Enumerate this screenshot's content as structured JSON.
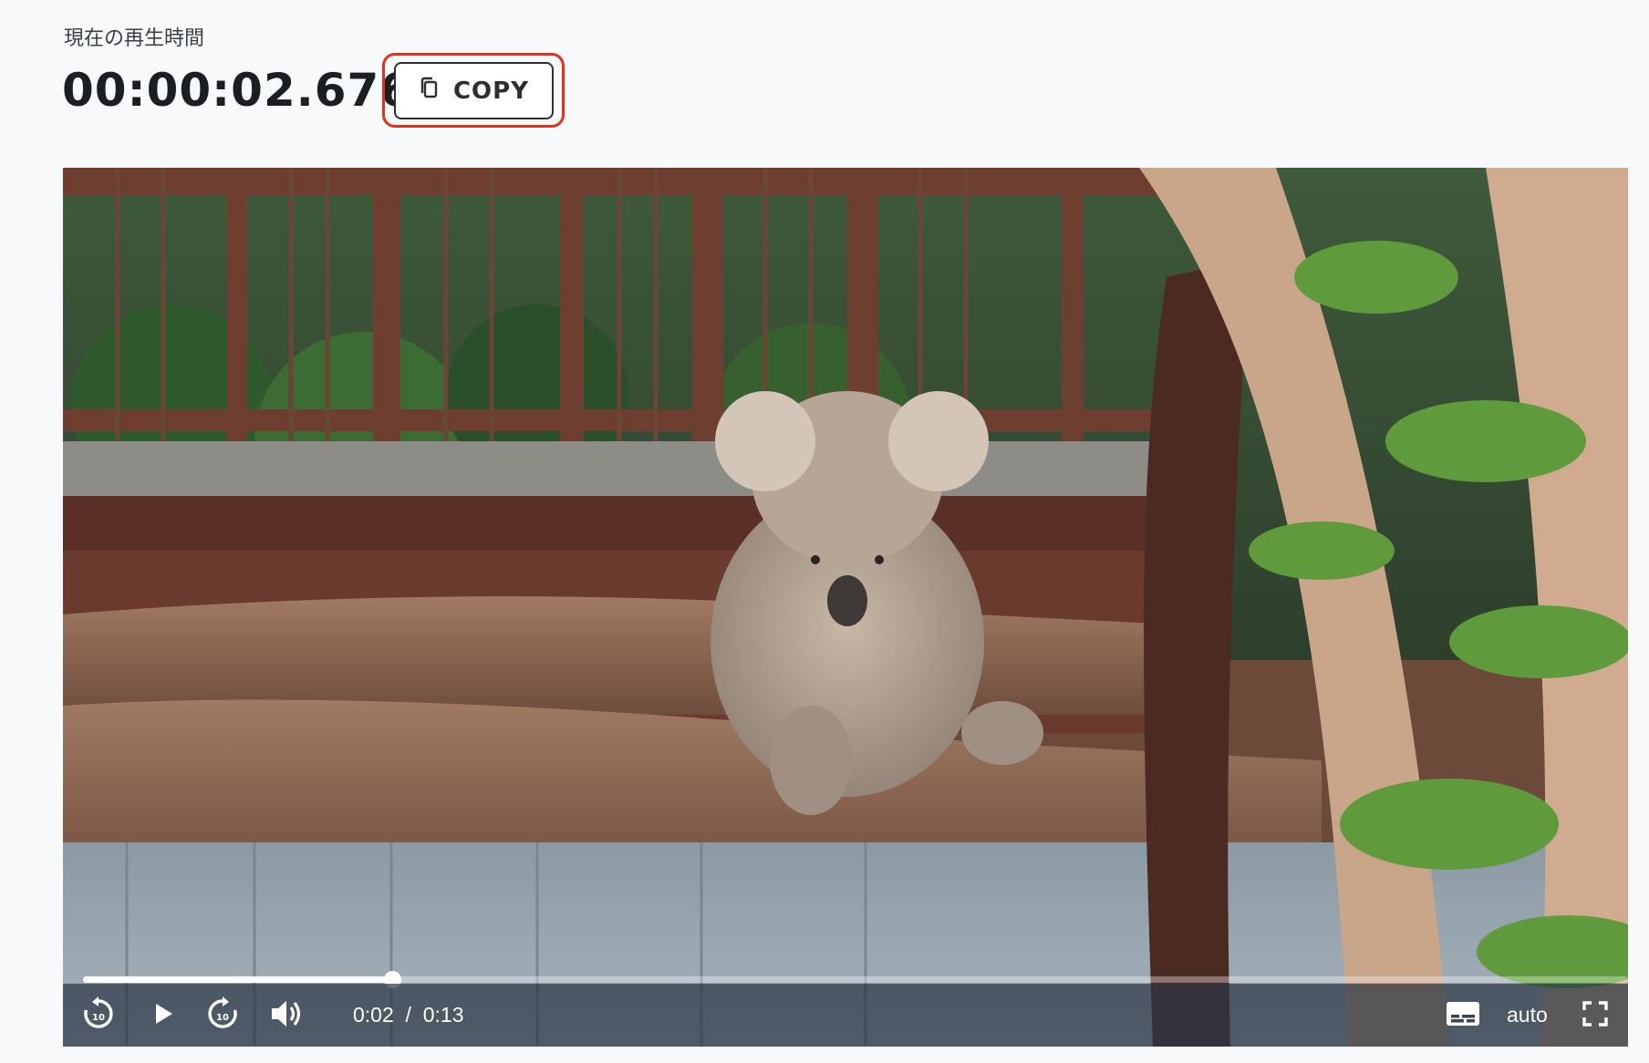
{
  "current_time": {
    "label": "現在の再生時間",
    "value": "00:00:02.676"
  },
  "copy_button": {
    "label": "COPY",
    "icon": "copy-icon",
    "highlight_color": "#e0331f"
  },
  "player": {
    "current": "0:02",
    "separator": "/",
    "duration": "0:13",
    "progress": 0.2,
    "quality": "auto",
    "icons": [
      "replay-10-icon",
      "play-icon",
      "forward-10-icon",
      "volume-icon",
      "subtitles-icon",
      "fullscreen-icon"
    ]
  },
  "video_description_hidden": ""
}
